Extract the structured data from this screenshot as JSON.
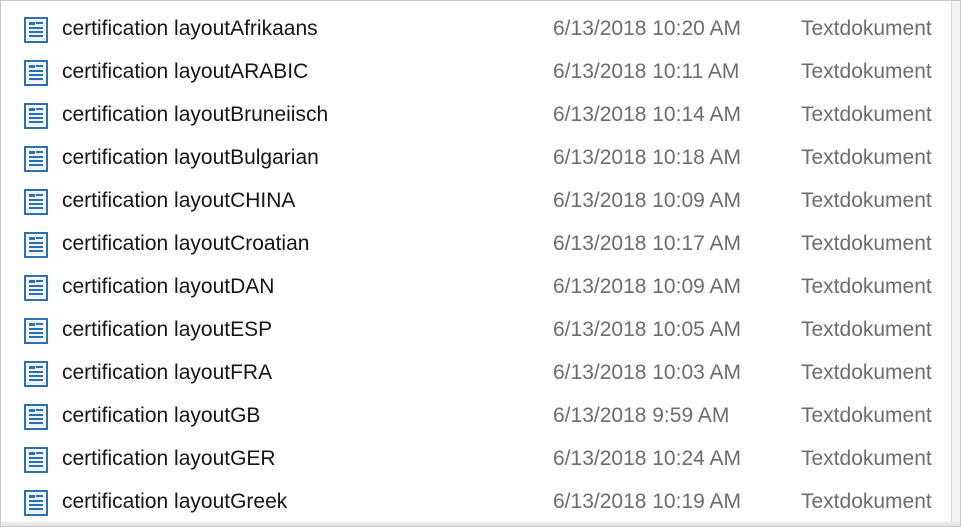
{
  "files": [
    {
      "name": "certification layoutAfrikaans",
      "date": "6/13/2018 10:20 AM",
      "type": "Textdokument",
      "icon": "text-document-icon"
    },
    {
      "name": "certification layoutARABIC",
      "date": "6/13/2018 10:11 AM",
      "type": "Textdokument",
      "icon": "text-document-icon"
    },
    {
      "name": "certification layoutBruneiisch",
      "date": "6/13/2018 10:14 AM",
      "type": "Textdokument",
      "icon": "text-document-icon"
    },
    {
      "name": "certification layoutBulgarian",
      "date": "6/13/2018 10:18 AM",
      "type": "Textdokument",
      "icon": "text-document-icon"
    },
    {
      "name": "certification layoutCHINA",
      "date": "6/13/2018 10:09 AM",
      "type": "Textdokument",
      "icon": "text-document-icon"
    },
    {
      "name": "certification layoutCroatian",
      "date": "6/13/2018 10:17 AM",
      "type": "Textdokument",
      "icon": "text-document-icon"
    },
    {
      "name": "certification layoutDAN",
      "date": "6/13/2018 10:09 AM",
      "type": "Textdokument",
      "icon": "text-document-icon"
    },
    {
      "name": "certification layoutESP",
      "date": "6/13/2018 10:05 AM",
      "type": "Textdokument",
      "icon": "text-document-icon"
    },
    {
      "name": "certification layoutFRA",
      "date": "6/13/2018 10:03 AM",
      "type": "Textdokument",
      "icon": "text-document-icon"
    },
    {
      "name": "certification layoutGB",
      "date": "6/13/2018 9:59 AM",
      "type": "Textdokument",
      "icon": "text-document-icon"
    },
    {
      "name": "certification layoutGER",
      "date": "6/13/2018 10:24 AM",
      "type": "Textdokument",
      "icon": "text-document-icon"
    },
    {
      "name": "certification layoutGreek",
      "date": "6/13/2018 10:19 AM",
      "type": "Textdokument",
      "icon": "text-document-icon"
    }
  ],
  "colors": {
    "name_text": "#151515",
    "meta_text": "#6d6d6d",
    "icon_blue": "#2b6fb5"
  }
}
